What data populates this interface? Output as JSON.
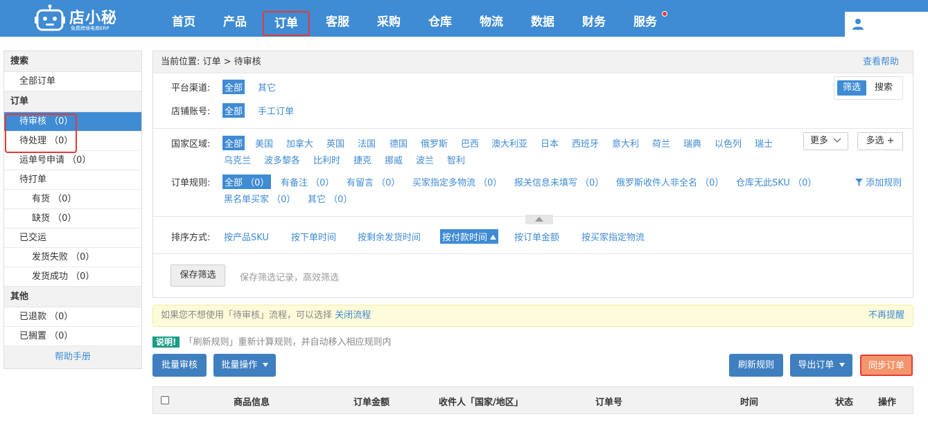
{
  "brand": {
    "name": "店小秘",
    "tagline": "免费跨境电商ERP"
  },
  "nav": {
    "items": [
      {
        "label": "首页"
      },
      {
        "label": "产品"
      },
      {
        "label": "订单"
      },
      {
        "label": "客服"
      },
      {
        "label": "采购"
      },
      {
        "label": "仓库"
      },
      {
        "label": "物流"
      },
      {
        "label": "数据"
      },
      {
        "label": "财务"
      },
      {
        "label": "服务"
      }
    ],
    "active": "订单"
  },
  "sidebar": {
    "search_head": "搜索",
    "all_orders": "全部订单",
    "order_head": "订单",
    "pending_review": "待审核 （0）",
    "pending_process": "待处理 （0）",
    "tracking_apply": "运单号申请 （0）",
    "to_print": "待打单",
    "in_stock": "有货 （0）",
    "out_stock": "缺货 （0）",
    "shipped": "已交运",
    "ship_fail": "发货失败 （0）",
    "ship_success": "发货成功 （0）",
    "other_head": "其他",
    "refunded": "已退款 （0）",
    "shelved": "已搁置 （0）",
    "help": "帮助手册"
  },
  "panel": {
    "breadcrumb": "当前位置:  订单 > 待审核",
    "help_link": "查看帮助",
    "platform_label": "平台渠道:",
    "platform_all": "全部",
    "platform_other": "其它",
    "shop_label": "店铺账号:",
    "shop_all": "全部",
    "shop_manual": "手工订单",
    "toggle_filter": "筛选",
    "toggle_search": "搜索",
    "country_label": "国家区域:",
    "countries": [
      "全部",
      "美国",
      "加拿大",
      "英国",
      "法国",
      "德国",
      "俄罗斯",
      "巴西",
      "澳大利亚",
      "日本",
      "西班牙",
      "意大利",
      "荷兰",
      "瑞典",
      "以色列",
      "瑞士"
    ],
    "countries2": [
      "乌克兰",
      "波多黎各",
      "比利时",
      "捷克",
      "挪威",
      "波兰",
      "智利"
    ],
    "more_btn": "更多",
    "multi_btn": "多选 +",
    "rule_label": "订单规则:",
    "rules": [
      "全部 （0）",
      "有备注 （0）",
      "有留言 （0）",
      "买家指定多物流 （0）",
      "报关信息未填写 （0）",
      "俄罗斯收件人非全名 （0）",
      "仓库无此SKU （0）"
    ],
    "rules2": [
      "黑名单买家 （0）",
      "其它 （0）"
    ],
    "add_rule": "添加规则",
    "sort_label": "排序方式:",
    "sorts": [
      "按产品SKU",
      "按下单时间",
      "按剩余发货时间",
      "按付款时间",
      "按订单金额",
      "按买家指定物流"
    ],
    "save_filter": "保存筛选",
    "save_hint": "保存筛选记录，高效筛选"
  },
  "notice": {
    "text": "如果您不想使用「待审核」流程，可以选择 ",
    "link": "关闭流程",
    "dismiss": "不再提醒"
  },
  "explain": {
    "badge": "说明!",
    "text": "「刷新规则」重新计算规则，并自动移入相应规则内"
  },
  "actions": {
    "batch_review": "批量审核",
    "batch_ops": "批量操作",
    "refresh_rules": "刷新规则",
    "export_orders": "导出订单",
    "sync_orders": "同步订单"
  },
  "table": {
    "headers": [
      "商品信息",
      "订单金额",
      "收件人「国家/地区」",
      "订单号",
      "时间",
      "状态",
      "操作"
    ]
  },
  "colors": {
    "primary": "#3f8bd4",
    "orange": "#f4956b",
    "highlight": "#e53935"
  }
}
